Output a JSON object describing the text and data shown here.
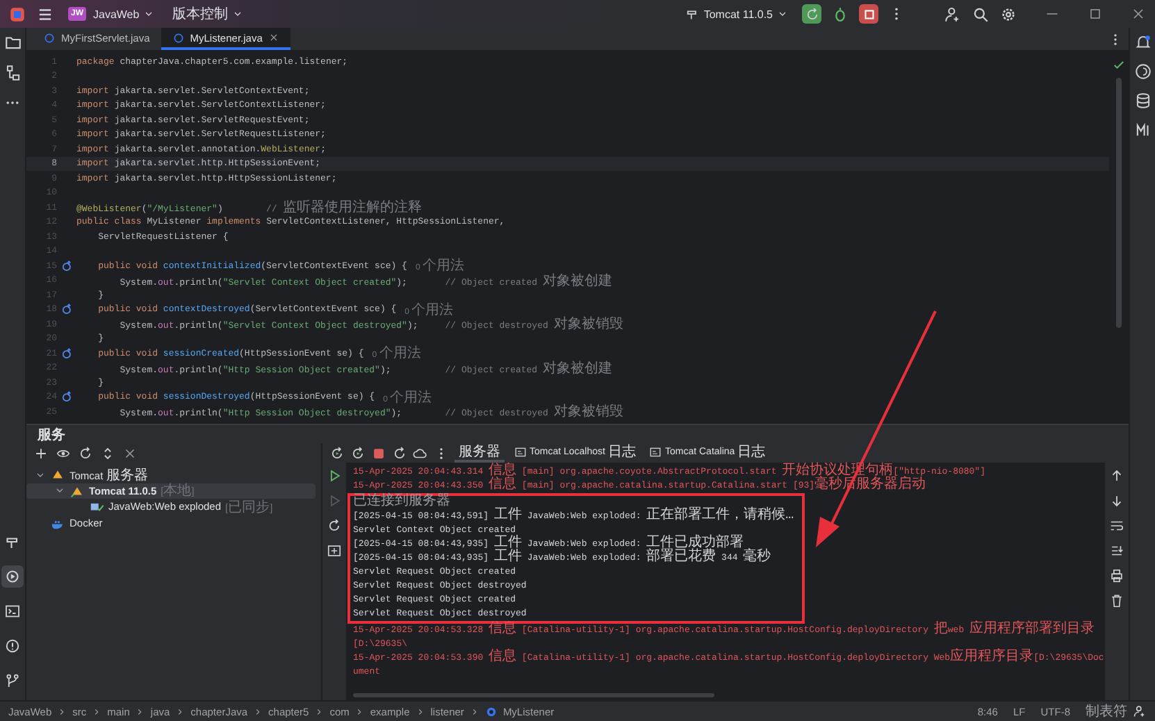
{
  "title_bar": {
    "project_badge": "JW",
    "project": "JavaWeb",
    "vcs": "版本控制",
    "run_config": "Tomcat 11.0.5"
  },
  "left_tools": [
    {
      "kind": "build",
      "selected": false
    },
    {
      "kind": "services",
      "selected": true
    },
    {
      "kind": "terminal",
      "selected": false
    },
    {
      "kind": "problems",
      "selected": false
    },
    {
      "kind": "git",
      "selected": false
    }
  ],
  "editor_tabs": [
    {
      "label": "MyFirstServlet.java",
      "selected": false
    },
    {
      "label": "MyListener.java",
      "selected": true
    }
  ],
  "editor": {
    "lines": [
      {
        "number": "1",
        "tokens": [
          {
            "kind": "kw",
            "text": "package "
          },
          {
            "kind": "plain",
            "text": "chapterJava.chapter5.com.example.listener;"
          }
        ]
      },
      {
        "number": "2"
      },
      {
        "number": "3",
        "tokens": [
          {
            "kind": "kw",
            "text": "import "
          },
          {
            "kind": "plain",
            "text": "jakarta.servlet.ServletContextEvent;"
          }
        ]
      },
      {
        "number": "4",
        "tokens": [
          {
            "kind": "kw",
            "text": "import "
          },
          {
            "kind": "plain",
            "text": "jakarta.servlet.ServletContextListener;"
          }
        ]
      },
      {
        "number": "5",
        "tokens": [
          {
            "kind": "kw",
            "text": "import "
          },
          {
            "kind": "plain",
            "text": "jakarta.servlet.ServletRequestEvent;"
          }
        ]
      },
      {
        "number": "6",
        "tokens": [
          {
            "kind": "kw",
            "text": "import "
          },
          {
            "kind": "plain",
            "text": "jakarta.servlet.ServletRequestListener;"
          }
        ]
      },
      {
        "number": "7",
        "tokens": [
          {
            "kind": "kw",
            "text": "import "
          },
          {
            "kind": "plain",
            "text": "jakarta.servlet.annotation."
          },
          {
            "kind": "ann",
            "text": "WebListener"
          },
          {
            "kind": "plain",
            "text": ";"
          }
        ]
      },
      {
        "number": "8",
        "current": true,
        "tokens": [
          {
            "kind": "kw",
            "text": "import "
          },
          {
            "kind": "plain",
            "text": "jakarta.servlet.http.HttpSessionEvent;"
          }
        ]
      },
      {
        "number": "9",
        "tokens": [
          {
            "kind": "kw",
            "text": "import "
          },
          {
            "kind": "plain",
            "text": "jakarta.servlet.http.HttpSessionListener;"
          }
        ]
      },
      {
        "number": "10"
      },
      {
        "number": "11",
        "tokens": [
          {
            "kind": "ann",
            "text": "@WebListener"
          },
          {
            "kind": "plain",
            "text": "("
          },
          {
            "kind": "str",
            "text": "\"/MyListener\""
          },
          {
            "kind": "plain",
            "text": ")"
          },
          {
            "kind": "comment",
            "text": "        // 监听器使用注解的注释"
          }
        ]
      },
      {
        "number": "12",
        "tokens": [
          {
            "kind": "kw",
            "text": "public class "
          },
          {
            "kind": "plain",
            "text": "MyListener "
          },
          {
            "kind": "kw",
            "text": "implements "
          },
          {
            "kind": "plain",
            "text": "ServletContextListener, HttpSessionListener,"
          }
        ]
      },
      {
        "number": "13",
        "tokens": [
          {
            "kind": "plain",
            "text": "    ServletRequestListener {"
          }
        ]
      },
      {
        "number": "14"
      },
      {
        "number": "15",
        "marker": true,
        "hint": "0 个用法",
        "tokens": [
          {
            "kind": "kw",
            "text": "    public void "
          },
          {
            "kind": "method",
            "text": "contextInitialized"
          },
          {
            "kind": "plain",
            "text": "(ServletContextEvent sce) {"
          }
        ]
      },
      {
        "number": "16",
        "tokens": [
          {
            "kind": "plain",
            "text": "        System."
          },
          {
            "kind": "field",
            "text": "out"
          },
          {
            "kind": "plain",
            "text": ".println("
          },
          {
            "kind": "str",
            "text": "\"Servlet Context Object created\""
          },
          {
            "kind": "plain",
            "text": ");"
          },
          {
            "kind": "comment",
            "text": "       // Object created 对象被创建"
          }
        ]
      },
      {
        "number": "17",
        "tokens": [
          {
            "kind": "plain",
            "text": "    }"
          }
        ]
      },
      {
        "number": "18",
        "marker": true,
        "hint": "0 个用法",
        "tokens": [
          {
            "kind": "kw",
            "text": "    public void "
          },
          {
            "kind": "method",
            "text": "contextDestroyed"
          },
          {
            "kind": "plain",
            "text": "(ServletContextEvent sce) {"
          }
        ]
      },
      {
        "number": "19",
        "tokens": [
          {
            "kind": "plain",
            "text": "        System."
          },
          {
            "kind": "field",
            "text": "out"
          },
          {
            "kind": "plain",
            "text": ".println("
          },
          {
            "kind": "str",
            "text": "\"Servlet Context Object destroyed\""
          },
          {
            "kind": "plain",
            "text": ");"
          },
          {
            "kind": "comment",
            "text": "     // Object destroyed 对象被销毁"
          }
        ]
      },
      {
        "number": "20",
        "tokens": [
          {
            "kind": "plain",
            "text": "    }"
          }
        ]
      },
      {
        "number": "21",
        "marker": true,
        "hint": "0 个用法",
        "tokens": [
          {
            "kind": "kw",
            "text": "    public void "
          },
          {
            "kind": "method",
            "text": "sessionCreated"
          },
          {
            "kind": "plain",
            "text": "(HttpSessionEvent se) {"
          }
        ]
      },
      {
        "number": "22",
        "tokens": [
          {
            "kind": "plain",
            "text": "        System."
          },
          {
            "kind": "field",
            "text": "out"
          },
          {
            "kind": "plain",
            "text": ".println("
          },
          {
            "kind": "str",
            "text": "\"Http Session Object created\""
          },
          {
            "kind": "plain",
            "text": ");"
          },
          {
            "kind": "comment",
            "text": "          // Object created 对象被创建"
          }
        ]
      },
      {
        "number": "23",
        "tokens": [
          {
            "kind": "plain",
            "text": "    }"
          }
        ]
      },
      {
        "number": "24",
        "marker": true,
        "hint": "0 个用法",
        "tokens": [
          {
            "kind": "kw",
            "text": "    public void "
          },
          {
            "kind": "method",
            "text": "sessionDestroyed"
          },
          {
            "kind": "plain",
            "text": "(HttpSessionEvent se) {"
          }
        ]
      },
      {
        "number": "25",
        "tokens": [
          {
            "kind": "plain",
            "text": "        System."
          },
          {
            "kind": "field",
            "text": "out"
          },
          {
            "kind": "plain",
            "text": ".println("
          },
          {
            "kind": "str",
            "text": "\"Http Session Object destroyed\""
          },
          {
            "kind": "plain",
            "text": ");"
          },
          {
            "kind": "comment",
            "text": "        // Object destroyed 对象被销毁"
          }
        ]
      }
    ]
  },
  "services": {
    "title": "服务",
    "tree": [
      {
        "kind": "server-group",
        "label": "Tomcat 服务器",
        "expanded": true,
        "selected": false,
        "children": [
          {
            "kind": "server",
            "label": "Tomcat 11.0.5",
            "tag": "[本地]",
            "expanded": true,
            "selected": true,
            "children": [
              {
                "kind": "artifact",
                "label": "JavaWeb:Web exploded",
                "tag": "[已同步]",
                "selected": false
              }
            ]
          }
        ]
      },
      {
        "kind": "docker",
        "label": "Docker",
        "selected": false
      }
    ],
    "console_tabs": [
      {
        "kind": "server",
        "label": "服务器",
        "selected": true
      },
      {
        "kind": "log",
        "label": "Tomcat Localhost 日志",
        "selected": false
      },
      {
        "kind": "log",
        "label": "Tomcat Catalina 日志",
        "selected": false
      }
    ],
    "console": [
      {
        "kind": "info",
        "highlighted": false,
        "text": "15-Apr-2025 20:04:43.314 信息 [main] org.apache.coyote.AbstractProtocol.start 开始协议处理句柄[\"http-nio-8080\"]"
      },
      {
        "kind": "info",
        "highlighted": false,
        "text": "15-Apr-2025 20:04:43.350 信息 [main] org.apache.catalina.startup.Catalina.start [93]毫秒后服务器启动"
      },
      {
        "kind": "system",
        "highlighted": true,
        "text": "已连接到服务器"
      },
      {
        "kind": "output",
        "highlighted": true,
        "text": "[2025-04-15 08:04:43,591] 工件 JavaWeb:Web exploded: 正在部署工件，请稍候…"
      },
      {
        "kind": "output",
        "highlighted": true,
        "text": "Servlet Context Object created"
      },
      {
        "kind": "output",
        "highlighted": true,
        "text": "[2025-04-15 08:04:43,935] 工件 JavaWeb:Web exploded: 工件已成功部署"
      },
      {
        "kind": "output",
        "highlighted": true,
        "text": "[2025-04-15 08:04:43,935] 工件 JavaWeb:Web exploded: 部署已花费 344 毫秒"
      },
      {
        "kind": "output",
        "highlighted": true,
        "text": "Servlet Request Object created"
      },
      {
        "kind": "output",
        "highlighted": true,
        "text": "Servlet Request Object destroyed"
      },
      {
        "kind": "output",
        "highlighted": true,
        "text": "Servlet Request Object created"
      },
      {
        "kind": "output",
        "highlighted": true,
        "text": "Servlet Request Object destroyed"
      },
      {
        "kind": "info",
        "highlighted": false,
        "text": "15-Apr-2025 20:04:53.328 信息 [Catalina-utility-1] org.apache.catalina.startup.HostConfig.deployDirectory 把web 应用程序部署到目录 [D:\\29635\\"
      },
      {
        "kind": "info",
        "highlighted": false,
        "text": "15-Apr-2025 20:04:53.390 信息 [Catalina-utility-1] org.apache.catalina.startup.HostConfig.deployDirectory Web应用程序目录[D:\\29635\\Document"
      }
    ]
  },
  "annotation_arrow": true,
  "status_bar": {
    "breadcrumbs": [
      "JavaWeb",
      "src",
      "main",
      "java",
      "chapterJava",
      "chapter5",
      "com",
      "example",
      "listener",
      "MyListener"
    ],
    "items": [
      "8:46",
      "LF",
      "UTF-8",
      "制表符"
    ]
  }
}
